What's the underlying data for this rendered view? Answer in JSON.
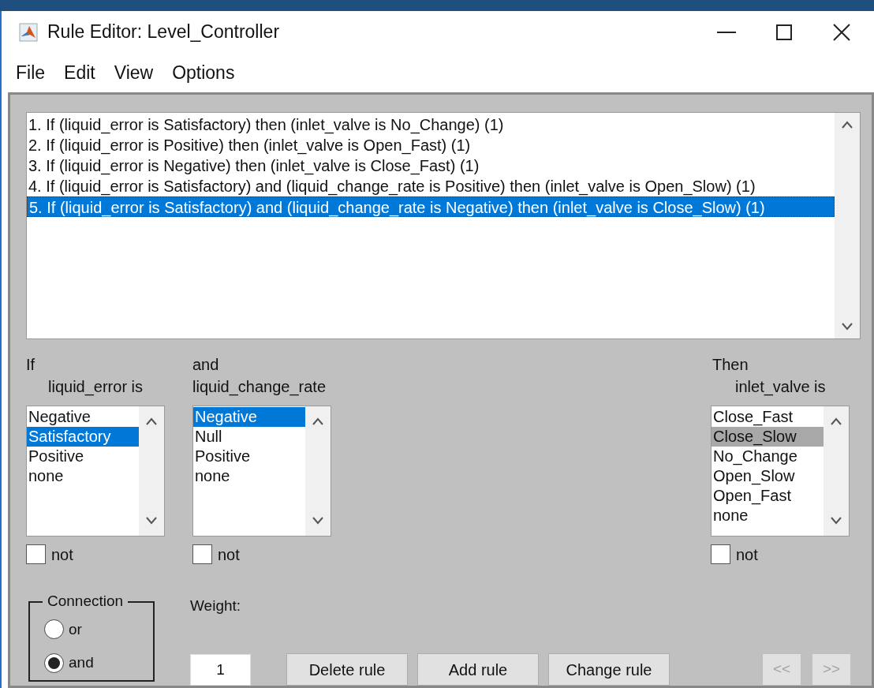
{
  "window": {
    "title": "Rule Editor: Level_Controller"
  },
  "menu": [
    "File",
    "Edit",
    "View",
    "Options"
  ],
  "rules": [
    {
      "text": "1. If (liquid_error is Satisfactory) then (inlet_valve is No_Change) (1)",
      "selected": false
    },
    {
      "text": "2. If (liquid_error is Positive) then (inlet_valve is Open_Fast) (1)",
      "selected": false
    },
    {
      "text": "3. If (liquid_error is Negative) then (inlet_valve is Close_Fast) (1)",
      "selected": false
    },
    {
      "text": "4. If (liquid_error is Satisfactory) and (liquid_change_rate is Positive) then (inlet_valve is Open_Slow) (1)",
      "selected": false
    },
    {
      "text": "5. If (liquid_error is Satisfactory) and (liquid_change_rate is Negative) then (inlet_valve is Close_Slow) (1)",
      "selected": true
    }
  ],
  "clauses": [
    {
      "heading": "If",
      "variable": "liquid_error is",
      "focused": true,
      "not": false,
      "items": [
        {
          "label": "Negative",
          "selected": false
        },
        {
          "label": "Satisfactory",
          "selected": true
        },
        {
          "label": "Positive",
          "selected": false
        },
        {
          "label": "none",
          "selected": false
        }
      ]
    },
    {
      "heading": "and",
      "variable": "liquid_change_rate",
      "focused": true,
      "not": false,
      "items": [
        {
          "label": "Negative",
          "selected": true
        },
        {
          "label": "Null",
          "selected": false
        },
        {
          "label": "Positive",
          "selected": false
        },
        {
          "label": "none",
          "selected": false
        }
      ]
    },
    {
      "heading": "Then",
      "variable": "inlet_valve is",
      "focused": false,
      "not": false,
      "items": [
        {
          "label": "Close_Fast",
          "selected": false
        },
        {
          "label": "Close_Slow",
          "selected": true
        },
        {
          "label": "No_Change",
          "selected": false
        },
        {
          "label": "Open_Slow",
          "selected": false
        },
        {
          "label": "Open_Fast",
          "selected": false
        },
        {
          "label": "none",
          "selected": false
        }
      ]
    }
  ],
  "not_label": [
    "not",
    "not",
    "not"
  ],
  "connection": {
    "title": "Connection",
    "options": [
      {
        "label": "or",
        "selected": false
      },
      {
        "label": "and",
        "selected": true
      }
    ]
  },
  "weight": {
    "label": "Weight:",
    "value": "1"
  },
  "buttons": [
    "Delete rule",
    "Add rule",
    "Change rule"
  ],
  "nav": [
    {
      "label": "<<",
      "disabled": true
    },
    {
      "label": ">>",
      "disabled": true
    }
  ]
}
